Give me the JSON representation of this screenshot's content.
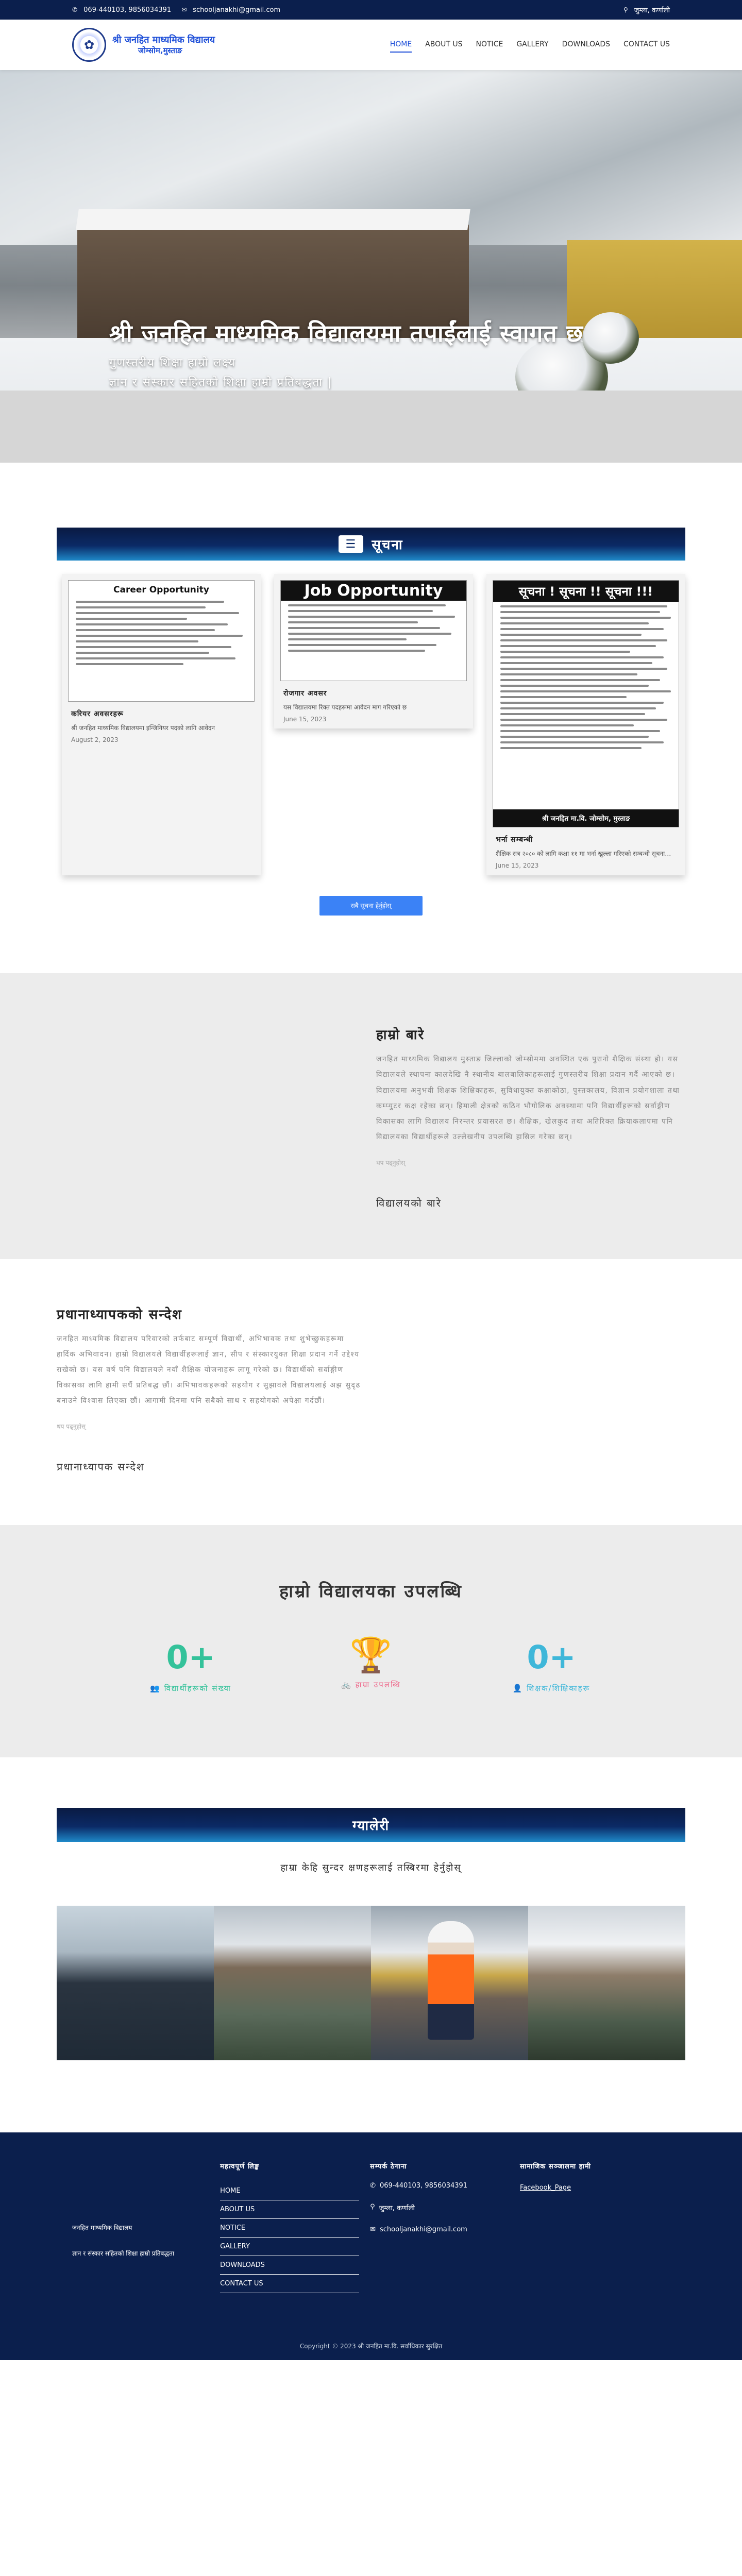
{
  "topbar": {
    "phone": "069-440103, 9856034391",
    "email": "schooljanakhi@gmail.com",
    "address": "जुम्ला, कर्णाली"
  },
  "header": {
    "school_name": "श्री जनहित माध्यमिक विद्यालय",
    "school_place": "जोम्सोम,मुस्ताङ",
    "nav": [
      "HOME",
      "ABOUT US",
      "NOTICE",
      "GALLERY",
      "DOWNLOADS",
      "CONTACT US"
    ]
  },
  "hero": {
    "title": "श्री जनहित माध्यमिक विद्यालयमा तपाईंलाई स्वागत छ",
    "subtitle1": "गुणस्तरीय शिक्षा हाम्रो लक्ष्य",
    "subtitle2": "ज्ञान र संस्कार सहितको शिक्षा हाम्रो प्रतिबद्धता |"
  },
  "notices": {
    "heading": "सूचना",
    "items": [
      {
        "img_title": "Career Opportunity",
        "title": "करियर अवसरहरू",
        "excerpt": "श्री जनहित माध्यमिक विद्यालयमा इन्जिनियर पदको लागि आवेदन",
        "date": "August 2, 2023"
      },
      {
        "img_title": "Job Opportunity",
        "title": "रोजगार अवसर",
        "excerpt": "यस विद्यालयमा रिक्त पदहरूमा आवेदन माग गरिएको छ",
        "date": "June 15, 2023"
      },
      {
        "img_title": "सूचना ! सूचना !! सूचना !!!",
        "img_footer": "श्री जनहित मा.वि. जोम्सोम, मुस्ताङ",
        "title": "भर्ना सम्बन्धी",
        "excerpt": "शैक्षिक सत्र २०८० को लागि कक्षा ११ मा भर्ना खुल्ला गरिएको सम्बन्धी सूचना…",
        "date": "June 15, 2023"
      }
    ],
    "view_all": "सबै सूचना हेर्नुहोस्"
  },
  "about": {
    "title": "हाम्रो बारे",
    "text": "जनहित माध्यमिक विद्यालय मुस्ताङ जिल्लाको जोम्सोममा अवस्थित एक पुरानो शैक्षिक संस्था हो। यस विद्यालयले स्थापना कालदेखि नै स्थानीय बालबालिकाहरूलाई गुणस्तरीय शिक्षा प्रदान गर्दै आएको छ। विद्यालयमा अनुभवी शिक्षक शिक्षिकाहरू, सुविधायुक्त कक्षाकोठा, पुस्तकालय, विज्ञान प्रयोगशाला तथा कम्प्युटर कक्ष रहेका छन्। हिमाली क्षेत्रको कठिन भौगोलिक अवस्थामा पनि विद्यार्थीहरूको सर्वाङ्गीण विकासका लागि विद्यालय निरन्तर प्रयासरत छ। शैक्षिक, खेलकुद तथा अतिरिक्त क्रियाकलापमा पनि विद्यालयका विद्यार्थीहरूले उल्लेखनीय उपलब्धि हासिल गरेका छन्।",
    "more": "थप पढ्नुहोस्",
    "subtitle": "विद्यालयको बारे"
  },
  "principal": {
    "title": "प्रधानाध्यापकको सन्देश",
    "text": "जनहित माध्यमिक विद्यालय परिवारको तर्फबाट सम्पूर्ण विद्यार्थी, अभिभावक तथा शुभेच्छुकहरूमा हार्दिक अभिवादन। हाम्रो विद्यालयले विद्यार्थीहरूलाई ज्ञान, सीप र संस्कारयुक्त शिक्षा प्रदान गर्ने उद्देश्य राखेको छ। यस वर्ष पनि विद्यालयले नयाँ शैक्षिक योजनाहरू लागू गरेको छ। विद्यार्थीको सर्वाङ्गीण विकासका लागि हामी सधैं प्रतिबद्ध छौं। अभिभावकहरूको सहयोग र सुझावले विद्यालयलाई अझ सुदृढ बनाउने विश्वास लिएका छौं। आगामी दिनमा पनि सबैको साथ र सहयोगको अपेक्षा गर्दछौं।",
    "more": "थप पढ्नुहोस्",
    "subtitle": "प्रधानाध्यापक सन्देश"
  },
  "stats": {
    "title": "हाम्रो विद्यालयका उपलब्धि",
    "items": [
      {
        "value": "0+",
        "label": "विद्यार्थीहरूको संख्या",
        "icon": "users-icon"
      },
      {
        "value": "",
        "label": "हाम्रा उपलब्धि",
        "icon": "trophy-icon"
      },
      {
        "value": "0+",
        "label": "शिक्षक/शिक्षिकाहरू",
        "icon": "user-icon"
      }
    ]
  },
  "gallery": {
    "heading": "ग्यालेरी",
    "lead": "हाम्रा केहि सुन्दर क्षणहरूलाई तस्बिरमा हेर्नुहोस्"
  },
  "footer": {
    "about_title": "जनहित माध्यमिक विद्यालय",
    "about_text": "ज्ञान र संस्कार सहितको शिक्षा हाम्रो प्रतिबद्धता",
    "links_title": "महत्वपूर्ण लिङ्क",
    "links": [
      "HOME",
      "ABOUT US",
      "NOTICE",
      "GALLERY",
      "DOWNLOADS",
      "CONTACT US"
    ],
    "contact_title": "सम्पर्क ठेगाना",
    "phone": "069-440103, 9856034391",
    "address": "जुम्ला, कर्णाली",
    "email": "schooljanakhi@gmail.com",
    "social_title": "सामाजिक सञ्जालमा हामी",
    "facebook": "Facebook_Page",
    "copyright": "Copyright © 2023 श्री जनहित मा.वि. सर्वाधिकार सुरक्षित"
  },
  "colors": {
    "navy": "#0b1f4d",
    "accent": "#1d4ed8",
    "green": "#34c29a",
    "pink": "#ee6a8c",
    "cyan": "#3fb7d9"
  }
}
